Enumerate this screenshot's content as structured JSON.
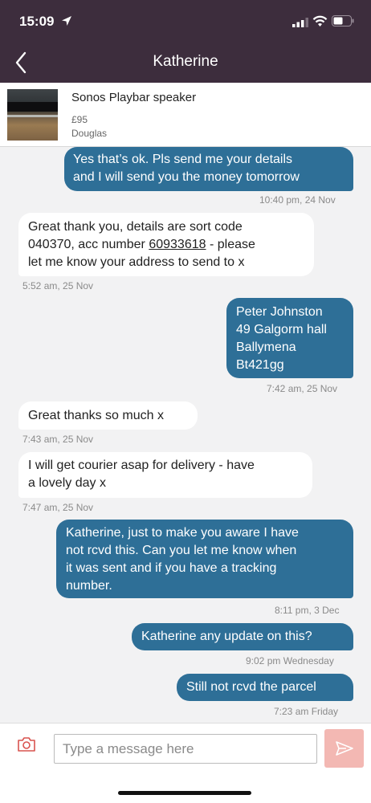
{
  "status_bar": {
    "time": "15:09"
  },
  "header": {
    "title": "Katherine"
  },
  "listing": {
    "title": "Sonos Playbar speaker",
    "price": "£95",
    "location": "Douglas"
  },
  "messages": [
    {
      "dir": "sent",
      "lines": [
        "Yes that’s ok. Pls send me your details",
        "and I will send you the money tomorrow"
      ],
      "time": "10:40 pm, 24 Nov"
    },
    {
      "dir": "recv",
      "lines": [
        "Great thank you, details are sort code",
        "040370, acc number ",
        "let me know your address to send to x"
      ],
      "link": "60933618",
      "link_suffix": " - please",
      "time": "5:52 am, 25 Nov"
    },
    {
      "dir": "sent",
      "lines": [
        "Peter Johnston",
        "49 Galgorm hall",
        "Ballymena",
        "Bt421gg"
      ],
      "time": "7:42 am, 25 Nov"
    },
    {
      "dir": "recv",
      "lines": [
        "Great thanks so much x"
      ],
      "time": "7:43 am, 25 Nov"
    },
    {
      "dir": "recv",
      "lines": [
        "I will get courier asap for delivery - have",
        "a lovely day x"
      ],
      "time": "7:47 am, 25 Nov"
    },
    {
      "dir": "sent",
      "lines": [
        "Katherine, just to make you aware I have",
        "not rcvd this. Can you let me know when",
        "it was sent and if you have a tracking",
        "number."
      ],
      "time": "8:11 pm, 3 Dec"
    },
    {
      "dir": "sent",
      "lines": [
        "Katherine any update on this?"
      ],
      "time": "9:02 pm Wednesday"
    },
    {
      "dir": "sent",
      "lines": [
        "Still not rcvd the parcel"
      ],
      "time": "7:23 am Friday"
    }
  ],
  "composer": {
    "placeholder": "Type a message here"
  },
  "colors": {
    "header": "#3d2d3d",
    "sent_bubble": "#2e6f97",
    "recv_bubble": "#ffffff",
    "background": "#f2f2f3",
    "send_button": "#f3b8b3"
  },
  "icons": [
    "location-arrow-icon",
    "signal-icon",
    "wifi-icon",
    "battery-icon",
    "back-chevron-icon",
    "camera-icon",
    "send-icon"
  ]
}
